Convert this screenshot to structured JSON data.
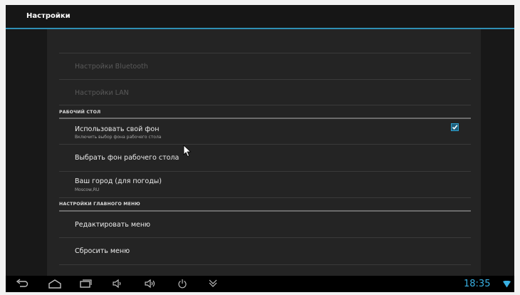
{
  "app": {
    "title": "Настройки"
  },
  "list": {
    "bluetooth": "Настройки Bluetooth",
    "lan": "Настройки LAN",
    "section_desktop": "РАБОЧИЙ СТОЛ",
    "wallpaper_title": "Использовать свой фон",
    "wallpaper_summary": "Включить выбор фона рабочего стола",
    "wallpaper_checked": true,
    "pick_wallpaper": "Выбрать фон рабочего стола",
    "city_title": "Ваш город (для погоды)",
    "city_value": "Moscow,RU",
    "section_main_menu": "НАСТРОЙКИ ГЛАВНОГО МЕНЮ",
    "edit_menu": "Редактировать меню",
    "reset_menu": "Сбросить меню"
  },
  "status": {
    "time": "18:35"
  },
  "colors": {
    "accent": "#2f8fb4",
    "clock": "#39b1e4",
    "background": "#1b1b1b"
  },
  "icons": [
    "back-icon",
    "home-icon",
    "recent-apps-icon",
    "volume-down-icon",
    "volume-up-icon",
    "power-icon",
    "hide-bar-icon",
    "wifi-icon",
    "checkmark-icon",
    "mouse-cursor-icon"
  ]
}
